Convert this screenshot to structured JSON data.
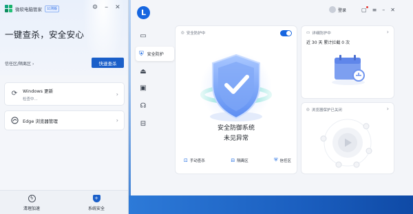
{
  "left_app": {
    "app_name": "微软电脑管家",
    "badge": "公测版",
    "slogan": "一键查杀，安全安心",
    "quarantine_link": "信任区/隔离区",
    "quick_scan_label": "快速查杀",
    "cards": [
      {
        "icon": "refresh-icon",
        "title": "Windows 更新",
        "subtitle": "检查中..."
      },
      {
        "icon": "edge-icon",
        "title": "Edge 浏览器管理",
        "subtitle": ""
      }
    ],
    "tabs": [
      {
        "icon": "bolt-icon",
        "label": "清理加速"
      },
      {
        "icon": "shield-icon",
        "label": "系统安全"
      }
    ]
  },
  "right_app": {
    "nav": {
      "active_label": "安全防护",
      "icons": [
        "monitor-icon",
        "shield-icon",
        "trash-icon",
        "archive-icon",
        "support-icon",
        "box-icon"
      ]
    },
    "header": {
      "login_label": "登录"
    },
    "protection_card": {
      "status_label": "安全防护中",
      "toggle_on": true,
      "title": "安全防御系统",
      "subtitle": "未见异常",
      "actions": [
        "手动查杀",
        "隔离区",
        "信任区"
      ]
    },
    "detail_card": {
      "title": "详细防护中",
      "stat": "近 30 天 累计拦截 0 次"
    },
    "browser_card": {
      "title": "浏览器保护已关闭"
    }
  },
  "colors": {
    "accent": "#1666e0",
    "scan_button": "#1a5fc9",
    "pcm_logo": "#10a37f"
  }
}
